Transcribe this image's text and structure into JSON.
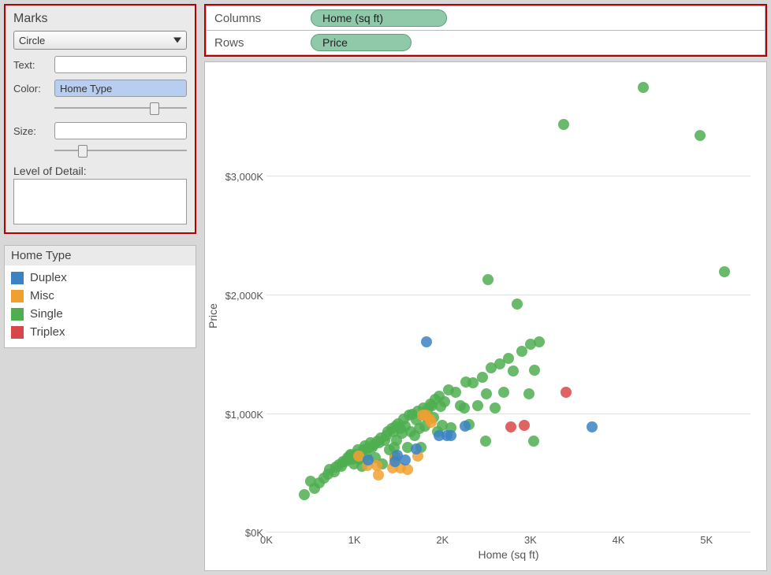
{
  "marks": {
    "title": "Marks",
    "shape": "Circle",
    "text_label": "Text:",
    "text_value": "",
    "color_label": "Color:",
    "color_value": "Home Type",
    "size_label": "Size:",
    "size_value": "",
    "lod_label": "Level of Detail:",
    "opacity_pos": 0.72,
    "size_pos": 0.18
  },
  "legend": {
    "title": "Home Type",
    "items": [
      {
        "label": "Duplex",
        "color": "#3b82c4"
      },
      {
        "label": "Misc",
        "color": "#f0a030"
      },
      {
        "label": "Single",
        "color": "#4fae50"
      },
      {
        "label": "Triplex",
        "color": "#d94848"
      }
    ]
  },
  "shelves": {
    "columns_label": "Columns",
    "rows_label": "Rows",
    "columns_pill": "Home (sq ft)",
    "rows_pill": "Price"
  },
  "chart_data": {
    "type": "scatter",
    "xlabel": "Home (sq ft)",
    "ylabel": "Price",
    "xlim": [
      0,
      5500
    ],
    "ylim": [
      0,
      3900
    ],
    "y_unit": "K",
    "y_prefix": "$",
    "x_ticks": [
      {
        "v": 0,
        "l": "0K"
      },
      {
        "v": 1000,
        "l": "1K"
      },
      {
        "v": 2000,
        "l": "2K"
      },
      {
        "v": 3000,
        "l": "3K"
      },
      {
        "v": 4000,
        "l": "4K"
      },
      {
        "v": 5000,
        "l": "5K"
      }
    ],
    "y_ticks": [
      {
        "v": 0,
        "l": "$0K"
      },
      {
        "v": 1000,
        "l": "$1,000K"
      },
      {
        "v": 2000,
        "l": "$2,000K"
      },
      {
        "v": 3000,
        "l": "$3,000K"
      }
    ],
    "colors": {
      "Duplex": "#3b82c4",
      "Misc": "#f0a030",
      "Single": "#4fae50",
      "Triplex": "#d94848"
    },
    "series": [
      {
        "name": "Single",
        "points": [
          [
            430,
            320
          ],
          [
            500,
            430
          ],
          [
            550,
            370
          ],
          [
            600,
            420
          ],
          [
            650,
            460
          ],
          [
            700,
            490
          ],
          [
            720,
            530
          ],
          [
            770,
            510
          ],
          [
            790,
            550
          ],
          [
            820,
            570
          ],
          [
            850,
            560
          ],
          [
            870,
            600
          ],
          [
            900,
            600
          ],
          [
            920,
            630
          ],
          [
            930,
            620
          ],
          [
            950,
            650
          ],
          [
            960,
            660
          ],
          [
            980,
            620
          ],
          [
            990,
            580
          ],
          [
            1000,
            640
          ],
          [
            1020,
            660
          ],
          [
            1040,
            700
          ],
          [
            1060,
            620
          ],
          [
            1080,
            560
          ],
          [
            1100,
            700
          ],
          [
            1120,
            730
          ],
          [
            1140,
            650
          ],
          [
            1160,
            710
          ],
          [
            1180,
            760
          ],
          [
            1200,
            720
          ],
          [
            1220,
            740
          ],
          [
            1240,
            630
          ],
          [
            1260,
            770
          ],
          [
            1280,
            760
          ],
          [
            1300,
            800
          ],
          [
            1320,
            580
          ],
          [
            1340,
            780
          ],
          [
            1360,
            820
          ],
          [
            1380,
            850
          ],
          [
            1400,
            700
          ],
          [
            1420,
            880
          ],
          [
            1440,
            850
          ],
          [
            1450,
            720
          ],
          [
            1460,
            640
          ],
          [
            1470,
            900
          ],
          [
            1480,
            780
          ],
          [
            1500,
            920
          ],
          [
            1520,
            880
          ],
          [
            1540,
            840
          ],
          [
            1560,
            960
          ],
          [
            1580,
            900
          ],
          [
            1600,
            720
          ],
          [
            1620,
            990
          ],
          [
            1640,
            850
          ],
          [
            1660,
            1000
          ],
          [
            1680,
            820
          ],
          [
            1700,
            950
          ],
          [
            1720,
            1020
          ],
          [
            1740,
            880
          ],
          [
            1760,
            720
          ],
          [
            1780,
            1050
          ],
          [
            1800,
            900
          ],
          [
            1820,
            980
          ],
          [
            1840,
            1040
          ],
          [
            1860,
            1080
          ],
          [
            1880,
            1070
          ],
          [
            1900,
            970
          ],
          [
            1920,
            1120
          ],
          [
            1940,
            850
          ],
          [
            1960,
            1150
          ],
          [
            1980,
            1060
          ],
          [
            2000,
            902
          ],
          [
            2020,
            1100
          ],
          [
            2070,
            1200
          ],
          [
            2100,
            885
          ],
          [
            2150,
            1180
          ],
          [
            2200,
            1070
          ],
          [
            2250,
            1050
          ],
          [
            2270,
            1270
          ],
          [
            2300,
            909
          ],
          [
            2350,
            1260
          ],
          [
            2400,
            1070
          ],
          [
            2450,
            1310
          ],
          [
            2490,
            768
          ],
          [
            2500,
            1170
          ],
          [
            2520,
            2136
          ],
          [
            2550,
            1390
          ],
          [
            2600,
            1050
          ],
          [
            2650,
            1420
          ],
          [
            2700,
            1180
          ],
          [
            2750,
            1470
          ],
          [
            2800,
            1360
          ],
          [
            2850,
            1930
          ],
          [
            2900,
            1530
          ],
          [
            2980,
            1170
          ],
          [
            3000,
            1590
          ],
          [
            3040,
            768
          ],
          [
            3050,
            1370
          ],
          [
            3100,
            1610
          ],
          [
            3380,
            3440
          ],
          [
            4280,
            3757
          ],
          [
            4930,
            3351
          ],
          [
            5200,
            2200
          ]
        ]
      },
      {
        "name": "Misc",
        "points": [
          [
            1050,
            642
          ],
          [
            1150,
            564
          ],
          [
            1250,
            564
          ],
          [
            1270,
            486
          ],
          [
            1430,
            548
          ],
          [
            1460,
            627
          ],
          [
            1520,
            548
          ],
          [
            1600,
            533
          ],
          [
            1720,
            643
          ],
          [
            1770,
            991
          ],
          [
            1810,
            991
          ],
          [
            1850,
            960
          ],
          [
            1870,
            929
          ]
        ]
      },
      {
        "name": "Duplex",
        "points": [
          [
            1160,
            611
          ],
          [
            1460,
            595
          ],
          [
            1490,
            650
          ],
          [
            1580,
            611
          ],
          [
            1700,
            706
          ],
          [
            1820,
            1607
          ],
          [
            1960,
            818
          ],
          [
            2050,
            818
          ],
          [
            2100,
            818
          ],
          [
            2260,
            896
          ],
          [
            3700,
            888
          ]
        ]
      },
      {
        "name": "Triplex",
        "points": [
          [
            2780,
            888
          ],
          [
            2930,
            904
          ],
          [
            3400,
            1180
          ]
        ]
      }
    ]
  }
}
